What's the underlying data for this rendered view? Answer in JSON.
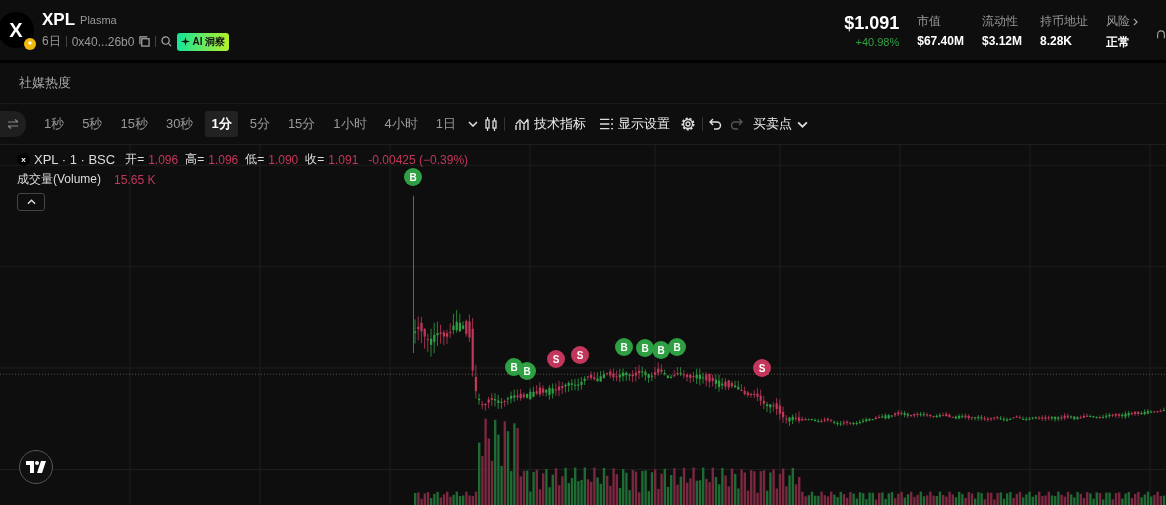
{
  "token": {
    "logo_letter": "X",
    "symbol": "XPL",
    "name": "Plasma",
    "age": "6日",
    "address": "0x40...26b0",
    "ai_badge": "AI 洞察"
  },
  "price": {
    "value": "$1.091",
    "change": "+40.98%"
  },
  "stats": [
    {
      "label": "市值",
      "value": "$67.40M",
      "kind": "plain"
    },
    {
      "label": "流动性",
      "value": "$3.12M",
      "kind": "plain"
    },
    {
      "label": "持币地址",
      "value": "8.28K",
      "kind": "plain"
    },
    {
      "label": "风险",
      "value": "正常",
      "kind": "link"
    }
  ],
  "section_tab": "社媒热度",
  "intervals": [
    {
      "label": "1秒",
      "selected": false
    },
    {
      "label": "5秒",
      "selected": false
    },
    {
      "label": "15秒",
      "selected": false
    },
    {
      "label": "30秒",
      "selected": false
    },
    {
      "label": "1分",
      "selected": true
    },
    {
      "label": "5分",
      "selected": false
    },
    {
      "label": "15分",
      "selected": false
    },
    {
      "label": "1小时",
      "selected": false
    },
    {
      "label": "4小时",
      "selected": false
    },
    {
      "label": "1日",
      "selected": false
    }
  ],
  "toolbar": {
    "indicators": "技术指标",
    "display": "显示设置",
    "trade_points": "买卖点"
  },
  "legend": {
    "logo_letter": "x",
    "title": "XPL · 1 · BSC",
    "ohlc": [
      {
        "label": "开=",
        "value": "1.096"
      },
      {
        "label": "高=",
        "value": "1.096"
      },
      {
        "label": "低=",
        "value": "1.090"
      },
      {
        "label": "收=",
        "value": "1.091"
      }
    ],
    "change": "-0.00425 (−0.39%)",
    "volume_label": "成交量(Volume)",
    "volume_value": "15.65 K"
  },
  "markers": [
    {
      "label": "B",
      "kind": "buy"
    },
    {
      "label": "B",
      "kind": "buy"
    },
    {
      "label": "B",
      "kind": "buy"
    },
    {
      "label": "S",
      "kind": "sell"
    },
    {
      "label": "S",
      "kind": "sell"
    },
    {
      "label": "B",
      "kind": "buy"
    },
    {
      "label": "B",
      "kind": "buy"
    },
    {
      "label": "B",
      "kind": "buy"
    },
    {
      "label": "B",
      "kind": "buy"
    },
    {
      "label": "S",
      "kind": "sell"
    }
  ]
}
